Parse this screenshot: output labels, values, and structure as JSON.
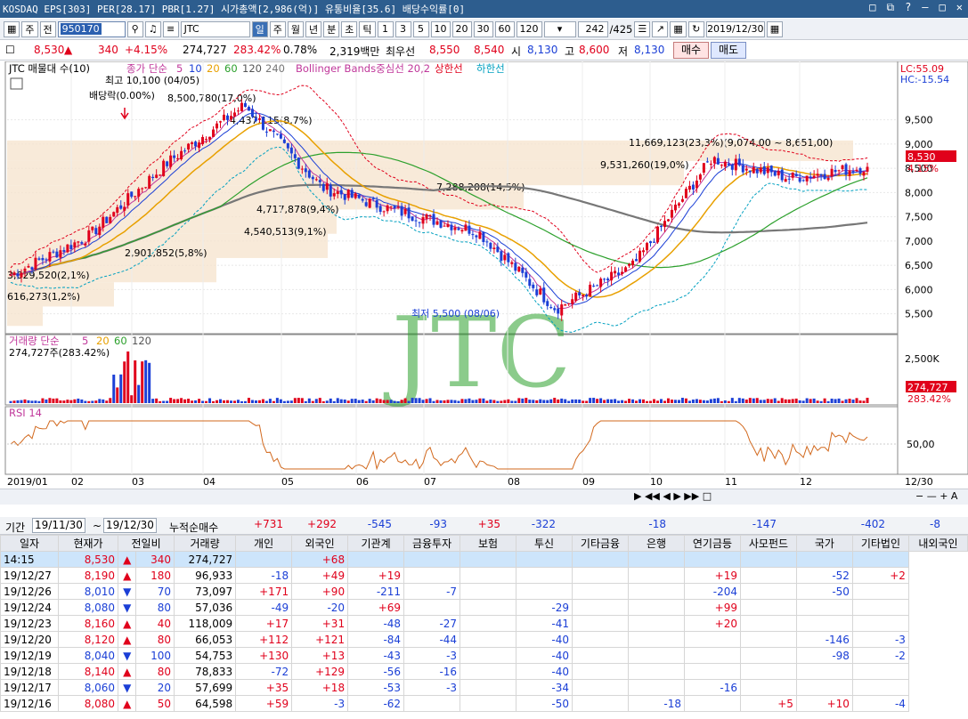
{
  "title_bar": {
    "text": "KOSDAQ EPS[303] PER[28.17] PBR[1.27] 시가총액[2,986(억)] 유통비율[35.6] 배당수익률[0]"
  },
  "toolbar": {
    "market": "주",
    "prev": "전",
    "code": "950170",
    "name": "JTC",
    "periods": [
      "일",
      "주",
      "월",
      "년",
      "분",
      "초",
      "틱"
    ],
    "active_period": "일",
    "intervals": [
      "1",
      "3",
      "5",
      "10",
      "20",
      "30",
      "60",
      "120"
    ],
    "count": "242",
    "total": "/425",
    "date": "2019/12/30"
  },
  "quote": {
    "price": "8,530",
    "arrow": "▲",
    "change": "340",
    "rate": "+4.15%",
    "volume": "274,727",
    "vol_rate": "283.42%",
    "turnover": "0.78%",
    "amount": "2,319백만",
    "pref_label": "최우선",
    "ask": "8,550",
    "bid": "8,540",
    "open_label": "시",
    "open": "8,130",
    "high_label": "고",
    "high": "8,600",
    "low_label": "저",
    "low": "8,130",
    "buy_label": "매수",
    "sell_label": "매도"
  },
  "chart": {
    "price_legend": "JTC 매물대 수(10)",
    "ma_legend_prefix": "종가 단순",
    "ma_legend_values": [
      "5",
      "10",
      "20",
      "60",
      "120",
      "240"
    ],
    "bb_legend": "Bollinger Bands중심선 20,2",
    "bb_upper": "상한선",
    "bb_lower": "하한선",
    "lc": "LC:55.09",
    "hc": "HC:-15.54",
    "current_price_tag": "8,530",
    "current_rate_tag": "4.15%",
    "high_note": "최고 10,100 (04/05)",
    "low_note": "최저 5,500 (08/06)",
    "dividend_note": "배당락(0.00%)",
    "watermark": "JTC",
    "volume_legend": "거래량 단순",
    "volume_ma": [
      "5",
      "20",
      "60",
      "120"
    ],
    "volume_info": "274,727주(283.42%)",
    "volume_tag": "274,727",
    "volume_tag2": "283.42%",
    "volume_axis": "2,500K",
    "rsi_legend": "RSI 14",
    "rsi_axis": "50,00",
    "x_axis": [
      "2019/01",
      "02",
      "03",
      "04",
      "05",
      "06",
      "07",
      "08",
      "09",
      "10",
      "11",
      "12",
      "12/30"
    ],
    "profile_labels": [
      "11,669,123(23,3%)(9,074,00 ~ 8,651,00)",
      "9,531,260(19,0%)",
      "7,288,208(14,5%)",
      "4,717,878(9,4%)",
      "4,540,513(9,1%)",
      "2,901,852(5,8%)",
      "3,029,520(2,1%)",
      "616,273(1,2%)",
      "8,500,780(17,0%)",
      "4,437,115(8,7%)"
    ]
  },
  "chart_data": {
    "type": "line",
    "x": [
      "2019/01",
      "02",
      "03",
      "04",
      "05",
      "06",
      "07",
      "08",
      "09",
      "10",
      "11",
      "12"
    ],
    "series": [
      {
        "name": "종가",
        "values": [
          6300,
          7100,
          8600,
          9800,
          8100,
          7600,
          7200,
          5600,
          6500,
          8700,
          8300,
          8530
        ]
      }
    ],
    "ylim": [
      5200,
      10300
    ],
    "ticks_y": [
      5500,
      6000,
      6500,
      7000,
      7500,
      8000,
      8500,
      9000,
      9500
    ]
  },
  "filter": {
    "period_label": "기간",
    "from": "19/11/30",
    "to": "19/12/30",
    "net_label": "누적순매수",
    "sums": [
      "+731",
      "+292",
      "-545",
      "-93",
      "+35",
      "-322",
      "",
      "-18",
      "",
      "-147",
      "",
      "-402",
      "-8"
    ]
  },
  "table": {
    "headers": [
      "일자",
      "현재가",
      "전일비",
      "거래량",
      "개인",
      "외국인",
      "기관계",
      "금융투자",
      "보험",
      "투신",
      "기타금융",
      "은행",
      "연기금등",
      "사모펀드",
      "국가",
      "기타법인",
      "내외국인"
    ],
    "rows": [
      [
        "14:15",
        "8,530",
        "▲",
        "340",
        "274,727",
        "",
        "+68",
        "",
        "",
        "",
        "",
        "",
        "",
        "",
        "",
        "",
        ""
      ],
      [
        "19/12/27",
        "8,190",
        "▲",
        "180",
        "96,933",
        "-18",
        "+49",
        "+19",
        "",
        "",
        "",
        "",
        "",
        "+19",
        "",
        "-52",
        "+2"
      ],
      [
        "19/12/26",
        "8,010",
        "▼",
        "70",
        "73,097",
        "+171",
        "+90",
        "-211",
        "-7",
        "",
        "",
        "",
        "",
        "-204",
        "",
        "-50",
        ""
      ],
      [
        "19/12/24",
        "8,080",
        "▼",
        "80",
        "57,036",
        "-49",
        "-20",
        "+69",
        "",
        "",
        "-29",
        "",
        "",
        "+99",
        "",
        "",
        ""
      ],
      [
        "19/12/23",
        "8,160",
        "▲",
        "40",
        "118,009",
        "+17",
        "+31",
        "-48",
        "-27",
        "",
        "-41",
        "",
        "",
        "+20",
        "",
        "",
        ""
      ],
      [
        "19/12/20",
        "8,120",
        "▲",
        "80",
        "66,053",
        "+112",
        "+121",
        "-84",
        "-44",
        "",
        "-40",
        "",
        "",
        "",
        "",
        "-146",
        "-3"
      ],
      [
        "19/12/19",
        "8,040",
        "▼",
        "100",
        "54,753",
        "+130",
        "+13",
        "-43",
        "-3",
        "",
        "-40",
        "",
        "",
        "",
        "",
        "-98",
        "-2"
      ],
      [
        "19/12/18",
        "8,140",
        "▲",
        "80",
        "78,833",
        "-72",
        "+129",
        "-56",
        "-16",
        "",
        "-40",
        "",
        "",
        "",
        "",
        "",
        ""
      ],
      [
        "19/12/17",
        "8,060",
        "▼",
        "20",
        "57,699",
        "+35",
        "+18",
        "-53",
        "-3",
        "",
        "-34",
        "",
        "",
        "-16",
        "",
        "",
        ""
      ],
      [
        "19/12/16",
        "8,080",
        "▲",
        "50",
        "64,598",
        "+59",
        "-3",
        "-62",
        "",
        "",
        "-50",
        "",
        "-18",
        "",
        "+5",
        "+10",
        "-4"
      ]
    ]
  }
}
